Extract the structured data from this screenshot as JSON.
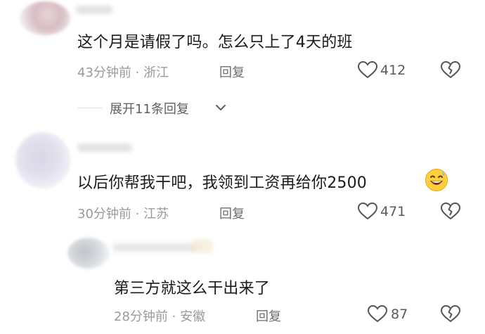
{
  "comments": [
    {
      "text": "这个月是请假了吗。怎么只上了4天的班",
      "time": "43分钟前",
      "location": "浙江",
      "reply_label": "回复",
      "likes": "412",
      "expand_label": "展开11条回复"
    },
    {
      "text": "以后你帮我干吧，我领到工资再给你2500",
      "time": "30分钟前",
      "location": "江苏",
      "reply_label": "回复",
      "likes": "471",
      "emoji": "grinning-sweat-emoji"
    },
    {
      "text": "第三方就这么干出来了",
      "time": "28分钟前",
      "location": "安徽",
      "reply_label": "回复",
      "likes": "87"
    }
  ],
  "separator": "·",
  "icons": {
    "like": "heart-outline-icon",
    "dislike": "broken-heart-icon",
    "expand": "chevron-down-icon"
  },
  "colors": {
    "text": "#1a1a1a",
    "meta": "#9a9a9a",
    "icon": "#555555"
  }
}
